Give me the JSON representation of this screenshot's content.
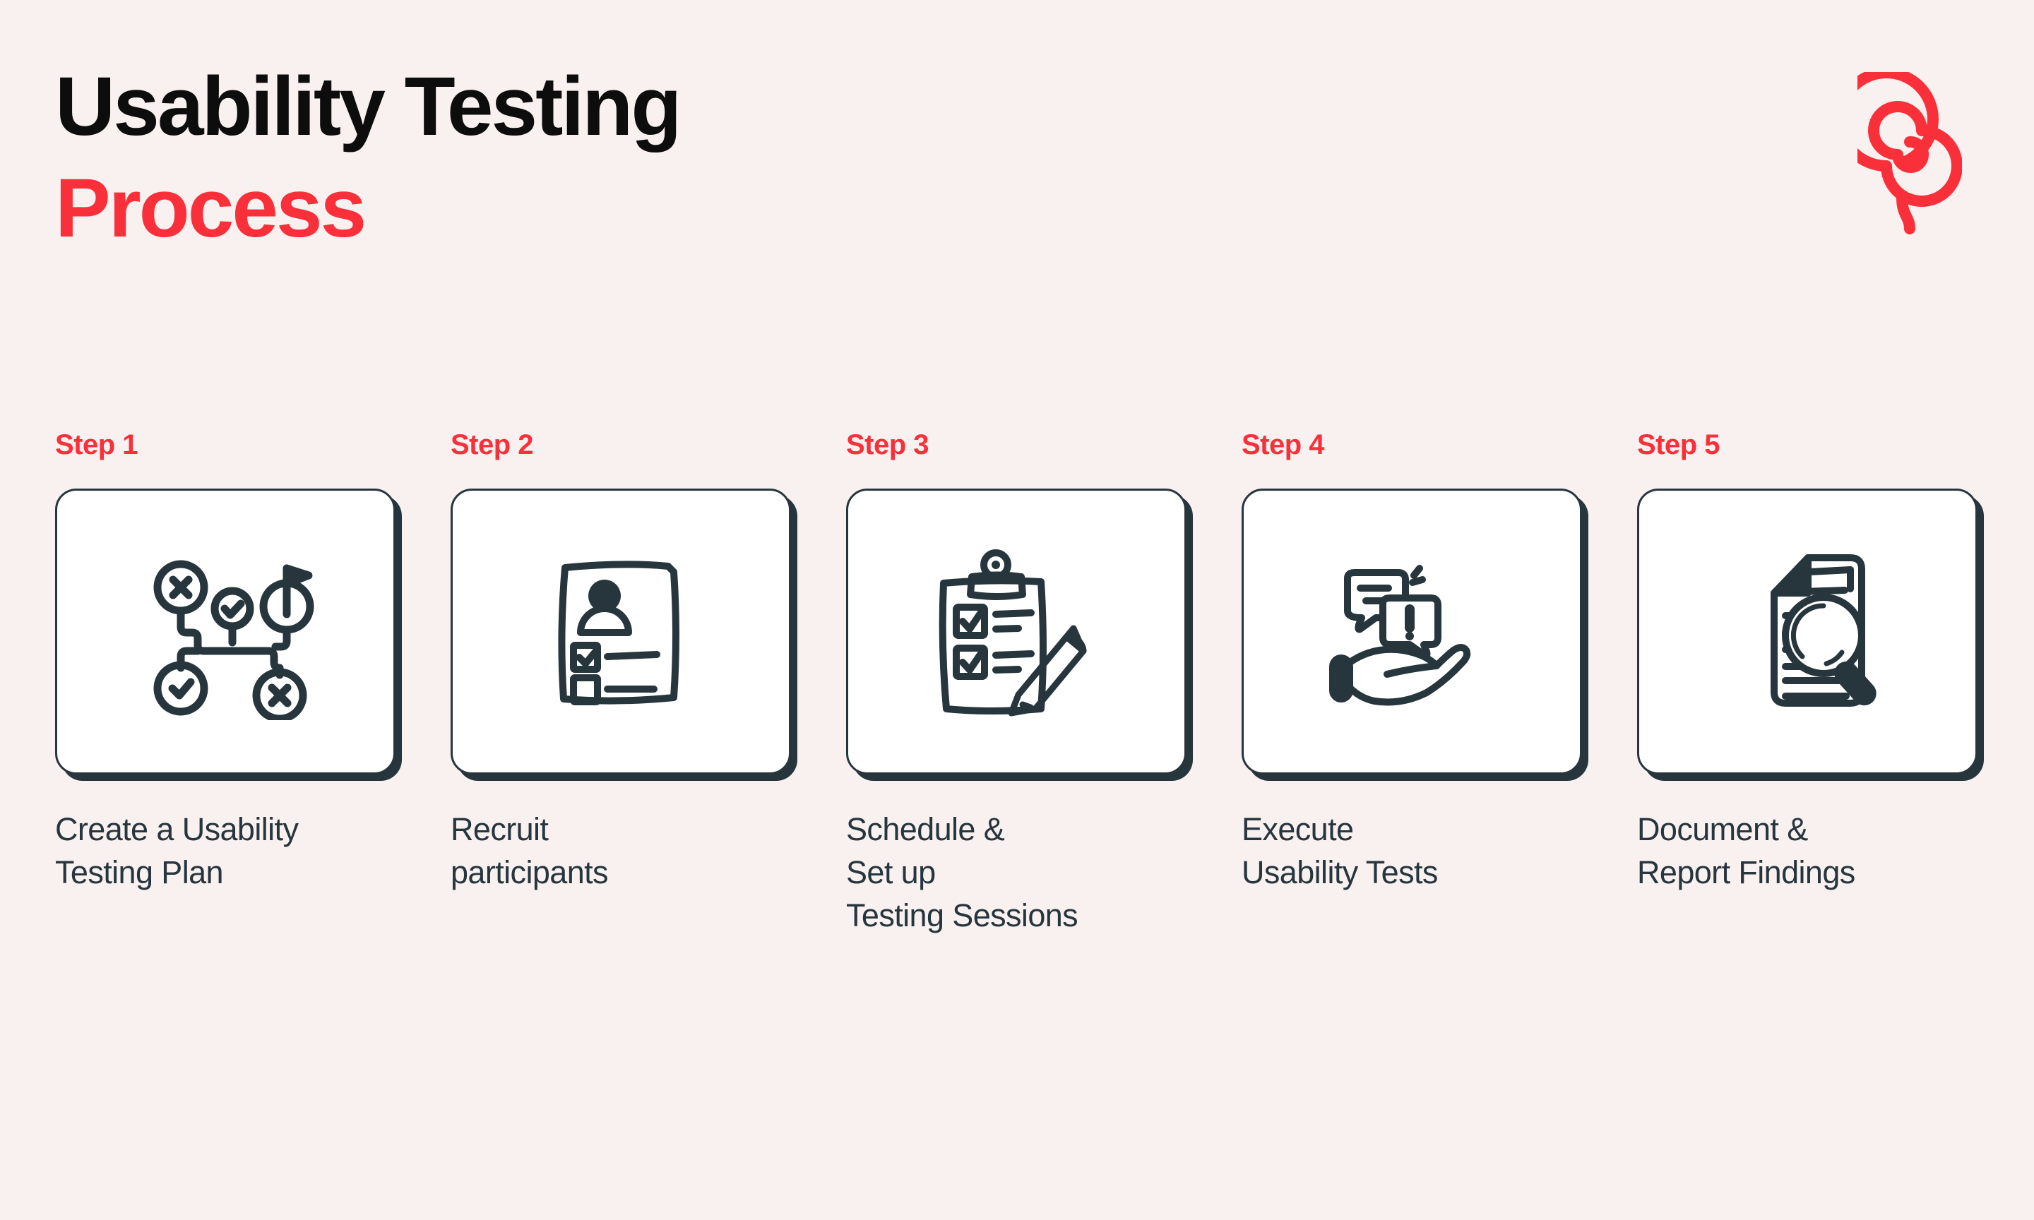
{
  "colors": {
    "background": "#F8F1F0",
    "accent_red": "#F9303A",
    "ink_dark": "#27353D",
    "title_black": "#0D0D0D",
    "card_white": "#FFFFFF"
  },
  "header": {
    "title_line_1": "Usability Testing",
    "title_line_2": "Process",
    "logo_name": "spiral-lollipop-logo"
  },
  "steps": [
    {
      "label": "Step 1",
      "icon": "flowchart-plan-icon",
      "caption": "Create a Usability\nTesting Plan"
    },
    {
      "label": "Step 2",
      "icon": "participant-profile-form-icon",
      "caption": "Recruit\nparticipants"
    },
    {
      "label": "Step 3",
      "icon": "clipboard-pencil-icon",
      "caption": "Schedule &\nSet up\nTesting Sessions"
    },
    {
      "label": "Step 4",
      "icon": "hand-speech-bubbles-icon",
      "caption": "Execute\nUsability Tests"
    },
    {
      "label": "Step 5",
      "icon": "document-magnifier-icon",
      "caption": "Document &\nReport Findings"
    }
  ]
}
